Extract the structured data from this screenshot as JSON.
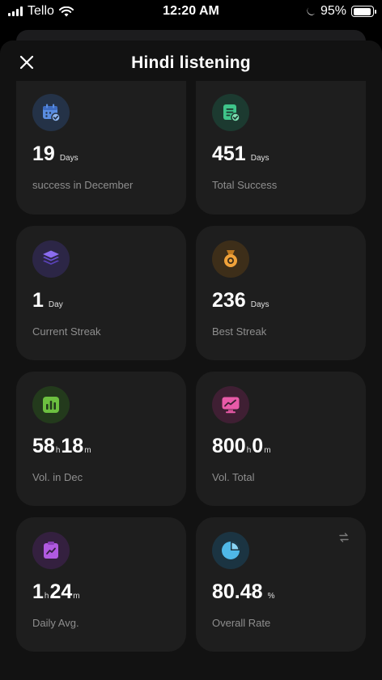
{
  "status": {
    "carrier": "Tello",
    "time": "12:20 AM",
    "battery": "95%"
  },
  "header": {
    "title": "Hindi listening"
  },
  "cards": [
    {
      "icon": "calendar-check-icon",
      "icon_color": "#5a8de0",
      "icon_bg": "#243247",
      "value": "19",
      "unit": "Days",
      "caption": "success in December"
    },
    {
      "icon": "checklist-icon",
      "icon_color": "#3fc48a",
      "icon_bg": "#1c3a30",
      "value": "451",
      "unit": "Days",
      "caption": "Total Success"
    },
    {
      "icon": "layers-icon",
      "icon_color": "#8b6cf0",
      "icon_bg": "#2c2646",
      "value": "1",
      "unit": "Day",
      "caption": "Current Streak"
    },
    {
      "icon": "medal-icon",
      "icon_color": "#f0a23a",
      "icon_bg": "#3d2e19",
      "value": "236",
      "unit": "Days",
      "caption": "Best Streak"
    },
    {
      "icon": "bar-chart-icon",
      "icon_color": "#6cc040",
      "icon_bg": "#233a1c",
      "h": "58",
      "h_unit": "h",
      "m": "18",
      "m_unit": "m",
      "caption": "Vol. in Dec"
    },
    {
      "icon": "monitor-trend-icon",
      "icon_color": "#e85aa8",
      "icon_bg": "#3f1f33",
      "h": "800",
      "h_unit": "h",
      "m": "0",
      "m_unit": "m",
      "caption": "Vol. Total"
    },
    {
      "icon": "clipboard-trend-icon",
      "icon_color": "#b05ae0",
      "icon_bg": "#34203f",
      "h": "1",
      "h_unit": "h",
      "m": "24",
      "m_unit": "m",
      "caption": "Daily Avg."
    },
    {
      "icon": "pie-chart-icon",
      "icon_color": "#4fb8e8",
      "icon_bg": "#1b3442",
      "value": "80.48",
      "unit": "%",
      "caption": "Overall Rate"
    }
  ]
}
